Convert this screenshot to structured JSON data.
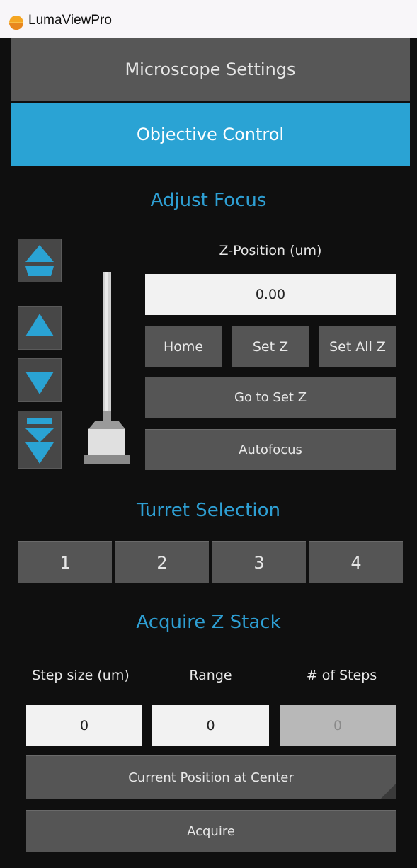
{
  "window": {
    "title": "LumaViewPro",
    "icon": "sun-icon"
  },
  "accordion": {
    "microscope_settings": "Microscope Settings",
    "objective_control": "Objective Control"
  },
  "focus": {
    "title": "Adjust Focus",
    "z_label": "Z-Position (um)",
    "z_value": "0.00",
    "home": "Home",
    "set_z": "Set Z",
    "set_all_z": "Set All Z",
    "go_to_set_z": "Go to Set Z",
    "autofocus": "Autofocus",
    "arrow_icons": [
      "double-up-arrow-icon",
      "up-arrow-icon",
      "down-arrow-icon",
      "double-down-arrow-icon"
    ]
  },
  "turret": {
    "title": "Turret Selection",
    "positions": [
      "1",
      "2",
      "3",
      "4"
    ]
  },
  "zstack": {
    "title": "Acquire Z Stack",
    "step_label": "Step size (um)",
    "range_label": "Range",
    "steps_label": "# of Steps",
    "step_value": "0",
    "range_value": "0",
    "steps_value": "0",
    "center_button": "Current Position at Center",
    "acquire_button": "Acquire"
  },
  "colors": {
    "accent": "#2aa3d4",
    "title_blue": "#2e9fd3",
    "panel_bg": "#0f0f0f",
    "button_bg": "#555555"
  }
}
